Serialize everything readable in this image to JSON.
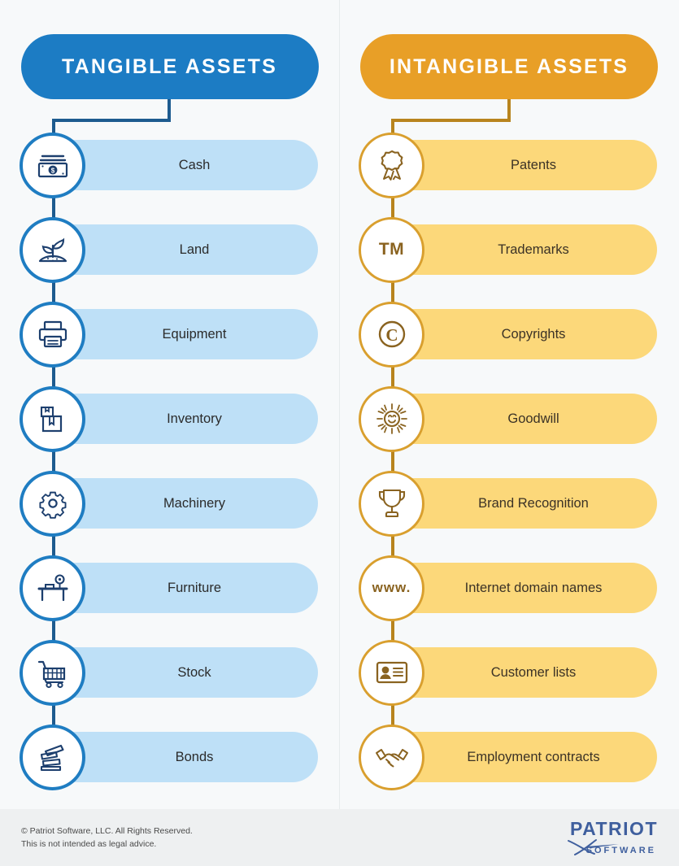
{
  "columns": [
    {
      "id": "tangible",
      "header": "TANGIBLE ASSETS",
      "header_color": "#1c7cc4",
      "pill_color": "#bee0f7",
      "accent_color": "#1f7dc2",
      "connector_color": "#1d5b8f",
      "items": [
        {
          "label": "Cash",
          "icon": "money-bill-icon"
        },
        {
          "label": "Land",
          "icon": "sprout-soil-icon"
        },
        {
          "label": "Equipment",
          "icon": "printer-icon"
        },
        {
          "label": "Inventory",
          "icon": "box-icon"
        },
        {
          "label": "Machinery",
          "icon": "gear-icon"
        },
        {
          "label": "Furniture",
          "icon": "desk-lamp-icon"
        },
        {
          "label": "Stock",
          "icon": "shopping-cart-icon"
        },
        {
          "label": "Bonds",
          "icon": "certificates-icon"
        }
      ]
    },
    {
      "id": "intangible",
      "header": "INTANGIBLE ASSETS",
      "header_color": "#e89f27",
      "pill_color": "#fcd87a",
      "accent_color": "#d99f2e",
      "connector_color": "#b8841e",
      "items": [
        {
          "label": "Patents",
          "icon": "award-ribbon-icon"
        },
        {
          "label": "Trademarks",
          "icon": "tm-text-icon",
          "glyph": "TM"
        },
        {
          "label": "Copyrights",
          "icon": "copyright-icon"
        },
        {
          "label": "Goodwill",
          "icon": "smiling-sun-icon"
        },
        {
          "label": "Brand Recognition",
          "icon": "trophy-icon"
        },
        {
          "label": "Internet domain names",
          "icon": "www-text-icon",
          "glyph": "www."
        },
        {
          "label": "Customer lists",
          "icon": "id-card-icon"
        },
        {
          "label": "Employment contracts",
          "icon": "handshake-icon"
        }
      ]
    }
  ],
  "footer": {
    "line1": "© Patriot Software, LLC. All Rights Reserved.",
    "line2": "This is not intended as legal advice.",
    "logo_main": "PATRIOT",
    "logo_sub": "SOFTWARE",
    "logo_color": "#3f5f9e"
  }
}
